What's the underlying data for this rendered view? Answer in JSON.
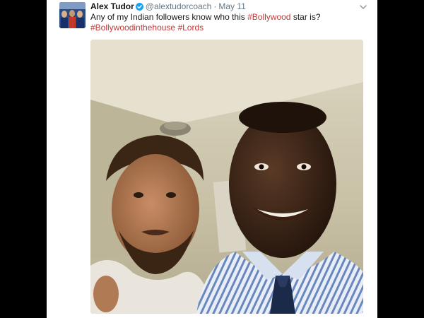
{
  "tweet": {
    "author_name": "Alex Tudor",
    "handle": "@alextudorcoach",
    "separator": "·",
    "date": "May 11",
    "text_before": "Any of my Indian followers know who this ",
    "hashtag_inline": "#Bollywood",
    "text_after": " star is?",
    "hashtag_1": "#Bollywoodinthehouse",
    "hashtag_2": "#Lords",
    "icons": [
      "verified-badge-icon",
      "chevron-down-icon"
    ],
    "colors": {
      "hashtag": "#c03a3a",
      "verified": "#1da1f2",
      "muted": "#657786"
    }
  }
}
